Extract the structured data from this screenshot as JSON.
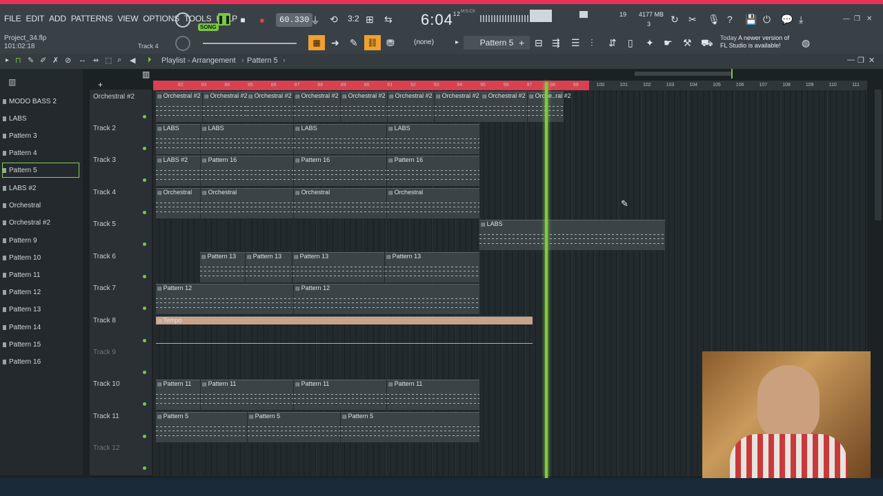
{
  "menu": [
    "FILE",
    "EDIT",
    "ADD",
    "PATTERNS",
    "VIEW",
    "OPTIONS",
    "TOOLS",
    "HELP"
  ],
  "transport": {
    "mode": "SONG",
    "tempo": "60.330",
    "time": "6:04",
    "time_frac": "12",
    "time_unit": "M:S:CS"
  },
  "meters": {
    "cpu": "19",
    "memory": "4177 MB",
    "poly": "3"
  },
  "project": {
    "name": "Project_34.flp",
    "position": "101:02:18",
    "hint_track": "Track 4"
  },
  "snap": "(none)",
  "pattern_selector": "Pattern 5",
  "notice": {
    "day": "Today",
    "line1": "A newer version of",
    "line2": "FL Studio is available!"
  },
  "playlist_title": "Playlist - Arrangement",
  "playlist_pattern": "Pattern 5",
  "side_items": [
    "MODO BASS 2",
    "LABS",
    "Pattern 3",
    "Pattern 4",
    "Pattern 5",
    "LABS #2",
    "Orchestral",
    "Orchestral #2",
    "Pattern 9",
    "Pattern 10",
    "Pattern 11",
    "Pattern 12",
    "Pattern 13",
    "Pattern 14",
    "Pattern 15",
    "Pattern 16"
  ],
  "tracks": [
    "Orchestral #2",
    "Track 2",
    "Track 3",
    "Track 4",
    "Track 5",
    "Track 6",
    "Track 7",
    "Track 8",
    "Track 9",
    "Track 10",
    "Track 11",
    "Track 12"
  ],
  "ruler_bars": [
    "82",
    "83",
    "84",
    "85",
    "86",
    "87",
    "88",
    "89",
    "90",
    "91",
    "92",
    "93",
    "94",
    "95",
    "96",
    "97",
    "98",
    "99",
    "100",
    "101",
    "102",
    "103",
    "104",
    "105",
    "106",
    "107",
    "108",
    "109",
    "110",
    "111"
  ],
  "clips": {
    "t1": [
      "Orchestral #2",
      "Orchestral #2",
      "Orchestral #2",
      "Orchestral #2",
      "Orchestral #2",
      "Orchestral #2",
      "Orchestral #2",
      "Orchestral #2",
      "Orche..ral #2"
    ],
    "t2": [
      "LABS",
      "LABS",
      "LABS",
      "LABS"
    ],
    "t3": [
      "LABS #2",
      "Pattern 16",
      "Pattern 16",
      "Pattern 16"
    ],
    "t4": [
      "Orchestral",
      "Orchestral",
      "Orchestral",
      "Orchestral"
    ],
    "t5": [
      "LABS"
    ],
    "t6": [
      "Pattern 13",
      "Pattern 13",
      "Pattern 13",
      "Pattern 13"
    ],
    "t7": [
      "Pattern 12",
      "Pattern 12"
    ],
    "t8": [
      "Tempo"
    ],
    "t10": [
      "Pattern 11",
      "Pattern 11",
      "Pattern 11",
      "Pattern 11"
    ],
    "t11": [
      "Pattern 5",
      "Pattern 5",
      "Pattern 5"
    ]
  },
  "colors": {
    "accent": "#e8325a",
    "playhead": "#7fcc3a",
    "tempo_clip": "#caa28a",
    "record": "#e04050"
  }
}
